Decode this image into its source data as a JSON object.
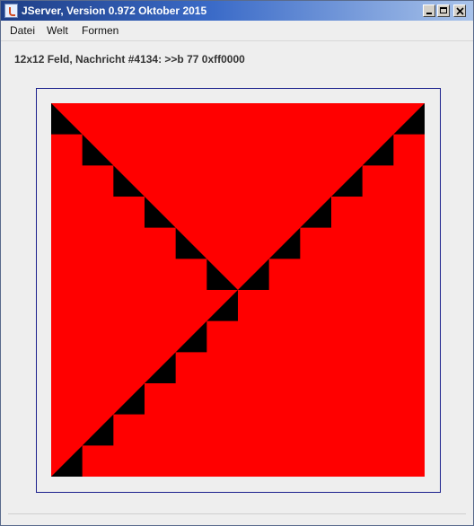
{
  "window": {
    "title": "JServer, Version 0.972 Oktober 2015"
  },
  "menu": {
    "items": [
      "Datei",
      "Welt",
      "Formen"
    ]
  },
  "status": {
    "text": "12x12 Feld, Nachricht #4134: >>b 77 0xff0000"
  },
  "board": {
    "rows": 12,
    "cols": 12,
    "fill_color": "#ff0000",
    "line_color": "#000000",
    "frame_color": "#1a1f8c",
    "background_color": "#eeeeee"
  }
}
